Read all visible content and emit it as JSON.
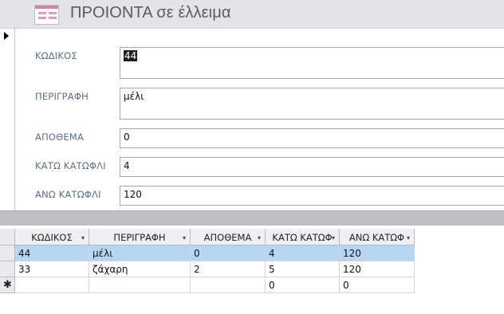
{
  "form": {
    "title": "ΠΡΟΙΟΝΤΑ σε έλλειμα",
    "fields": [
      {
        "label": "ΚΩΔΙΚΟΣ",
        "value": "44"
      },
      {
        "label": "ΠΕΡΙΓΡΑΦΗ",
        "value": "μέλι"
      },
      {
        "label": "ΑΠΟΘΕΜΑ",
        "value": "0"
      },
      {
        "label": "ΚΑΤΩ ΚΑΤΩΦΛΙ",
        "value": "4"
      },
      {
        "label": "ΑΝΩ ΚΑΤΩΦΛΙ",
        "value": "120"
      }
    ]
  },
  "datasheet": {
    "columns": [
      "ΚΩΔΙΚΟΣ",
      "ΠΕΡΙΓΡΑΦΗ",
      "ΑΠΟΘΕΜΑ",
      "ΚΑΤΩ ΚΑΤΩΦ",
      "ΑΝΩ ΚΑΤΩΦ"
    ],
    "sort_glyph": "▾",
    "new_row_marker": "✱",
    "rows": [
      [
        "44",
        "μέλι",
        "0",
        "4",
        "120"
      ],
      [
        "33",
        "ζάχαρη",
        "2",
        "5",
        "120"
      ],
      [
        "",
        "",
        "",
        "0",
        "0"
      ]
    ]
  }
}
